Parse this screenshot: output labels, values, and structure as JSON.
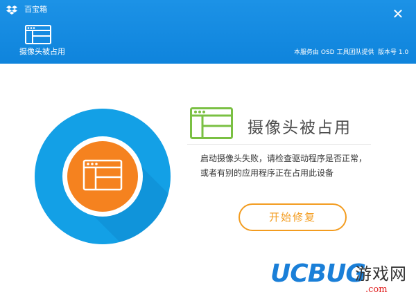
{
  "titlebar": {
    "app_name": "百宝箱",
    "close_glyph": "✕",
    "logo_icon": "dropbox-icon"
  },
  "tab": {
    "label": "摄像头被占用",
    "icon": "window-icon"
  },
  "header_info": {
    "provider": "本服务由 OSD 工具团队提供",
    "version": "版本号 1.0"
  },
  "main": {
    "title": "摄像头被占用",
    "description_lines": [
      "启动摄像头失败，请检查驱动程序是否正常，",
      "或者有别的应用程序正在占用此设备"
    ],
    "repair_button": "开始修复"
  },
  "watermark": {
    "brand": "UCBUG",
    "tagline": "游戏网",
    "domain": ".com"
  },
  "colors": {
    "header_blue": "#1089e0",
    "circle_blue": "#13a0e6",
    "orange": "#f5821f",
    "green": "#7ac043",
    "button_orange": "#f39c1f"
  }
}
